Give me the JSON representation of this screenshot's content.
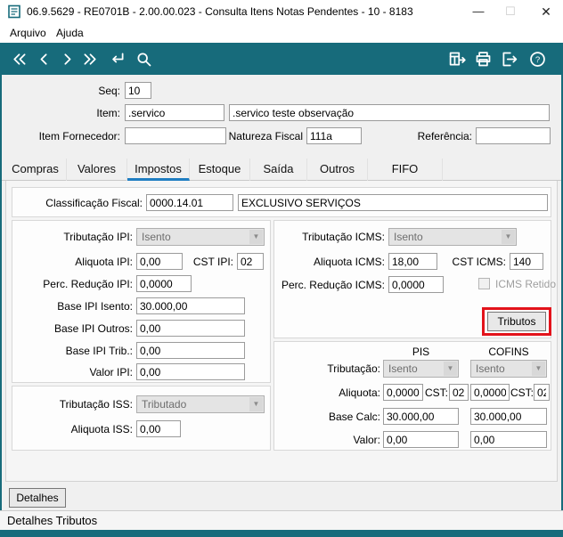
{
  "colors": {
    "toolbar_teal": "#176B7B",
    "tab_active_blue": "#1F7EC2",
    "highlight_red": "#E3131B"
  },
  "window": {
    "title": "06.9.5629 - RE0701B - 2.00.00.023 - Consulta Itens Notas Pendentes - 10 - 8183",
    "minimize_glyph": "—",
    "maximize_glyph": "☐",
    "close_glyph": "✕"
  },
  "menubar": {
    "arquivo": "Arquivo",
    "ajuda": "Ajuda"
  },
  "header": {
    "seq": {
      "label": "Seq:",
      "value": "10"
    },
    "item": {
      "label": "Item:",
      "value": ".servico"
    },
    "item_desc": {
      "value": ".servico teste observação"
    },
    "item_fornecedor": {
      "label": "Item Fornecedor:",
      "value": ""
    },
    "natureza_fiscal": {
      "label": "Natureza Fiscal",
      "value": "111a"
    },
    "referencia": {
      "label": "Referência:",
      "value": ""
    }
  },
  "tabs": {
    "active": "Impostos",
    "items": [
      {
        "label": "Compras"
      },
      {
        "label": "Valores"
      },
      {
        "label": "Impostos"
      },
      {
        "label": "Estoque"
      },
      {
        "label": "Saída"
      },
      {
        "label": "Outros"
      },
      {
        "label": "FIFO"
      }
    ]
  },
  "impostos": {
    "classificacao": {
      "label": "Classificação Fiscal:",
      "code": "0000.14.01",
      "descricao": "EXCLUSIVO SERVIÇOS"
    },
    "ipi": {
      "tributacao_label": "Tributação IPI:",
      "tributacao_value": "Isento",
      "aliquota_label": "Aliquota IPI:",
      "aliquota_value": "0,00",
      "cst_label": "CST IPI:",
      "cst_value": "02",
      "perc_reducao_label": "Perc. Redução IPI:",
      "perc_reducao_value": "0,0000",
      "base_isento_label": "Base IPI Isento:",
      "base_isento_value": "30.000,00",
      "base_outros_label": "Base IPI Outros:",
      "base_outros_value": "0,00",
      "base_trib_label": "Base IPI Trib.:",
      "base_trib_value": "0,00",
      "valor_label": "Valor IPI:",
      "valor_value": "0,00"
    },
    "icms": {
      "tributacao_label": "Tributação ICMS:",
      "tributacao_value": "Isento",
      "aliquota_label": "Aliquota ICMS:",
      "aliquota_value": "18,00",
      "cst_label": "CST ICMS:",
      "cst_value": "140",
      "perc_reducao_label": "Perc. Redução ICMS:",
      "perc_reducao_value": "0,0000",
      "icms_retido_label": "ICMS Retido",
      "tributos_button": "Tributos"
    },
    "pis_cofins": {
      "header_pis": "PIS",
      "header_cofins": "COFINS",
      "tributacao_label": "Tributação:",
      "pis_tributacao": "Isento",
      "cofins_tributacao": "Isento",
      "aliquota_label": "Aliquota:",
      "pis_aliquota": "0,0000",
      "cofins_aliquota": "0,0000",
      "cst_label": "CST:",
      "pis_cst": "02",
      "cofins_cst": "02",
      "base_label": "Base Calc:",
      "pis_base": "30.000,00",
      "cofins_base": "30.000,00",
      "valor_label": "Valor:",
      "pis_valor": "0,00",
      "cofins_valor": "0,00"
    },
    "iss": {
      "tributacao_label": "Tributação ISS:",
      "tributacao_value": "Tributado",
      "aliquota_label": "Aliquota ISS:",
      "aliquota_value": "0,00"
    }
  },
  "footer": {
    "detalhes_button": "Detalhes",
    "status": "Detalhes Tributos"
  }
}
